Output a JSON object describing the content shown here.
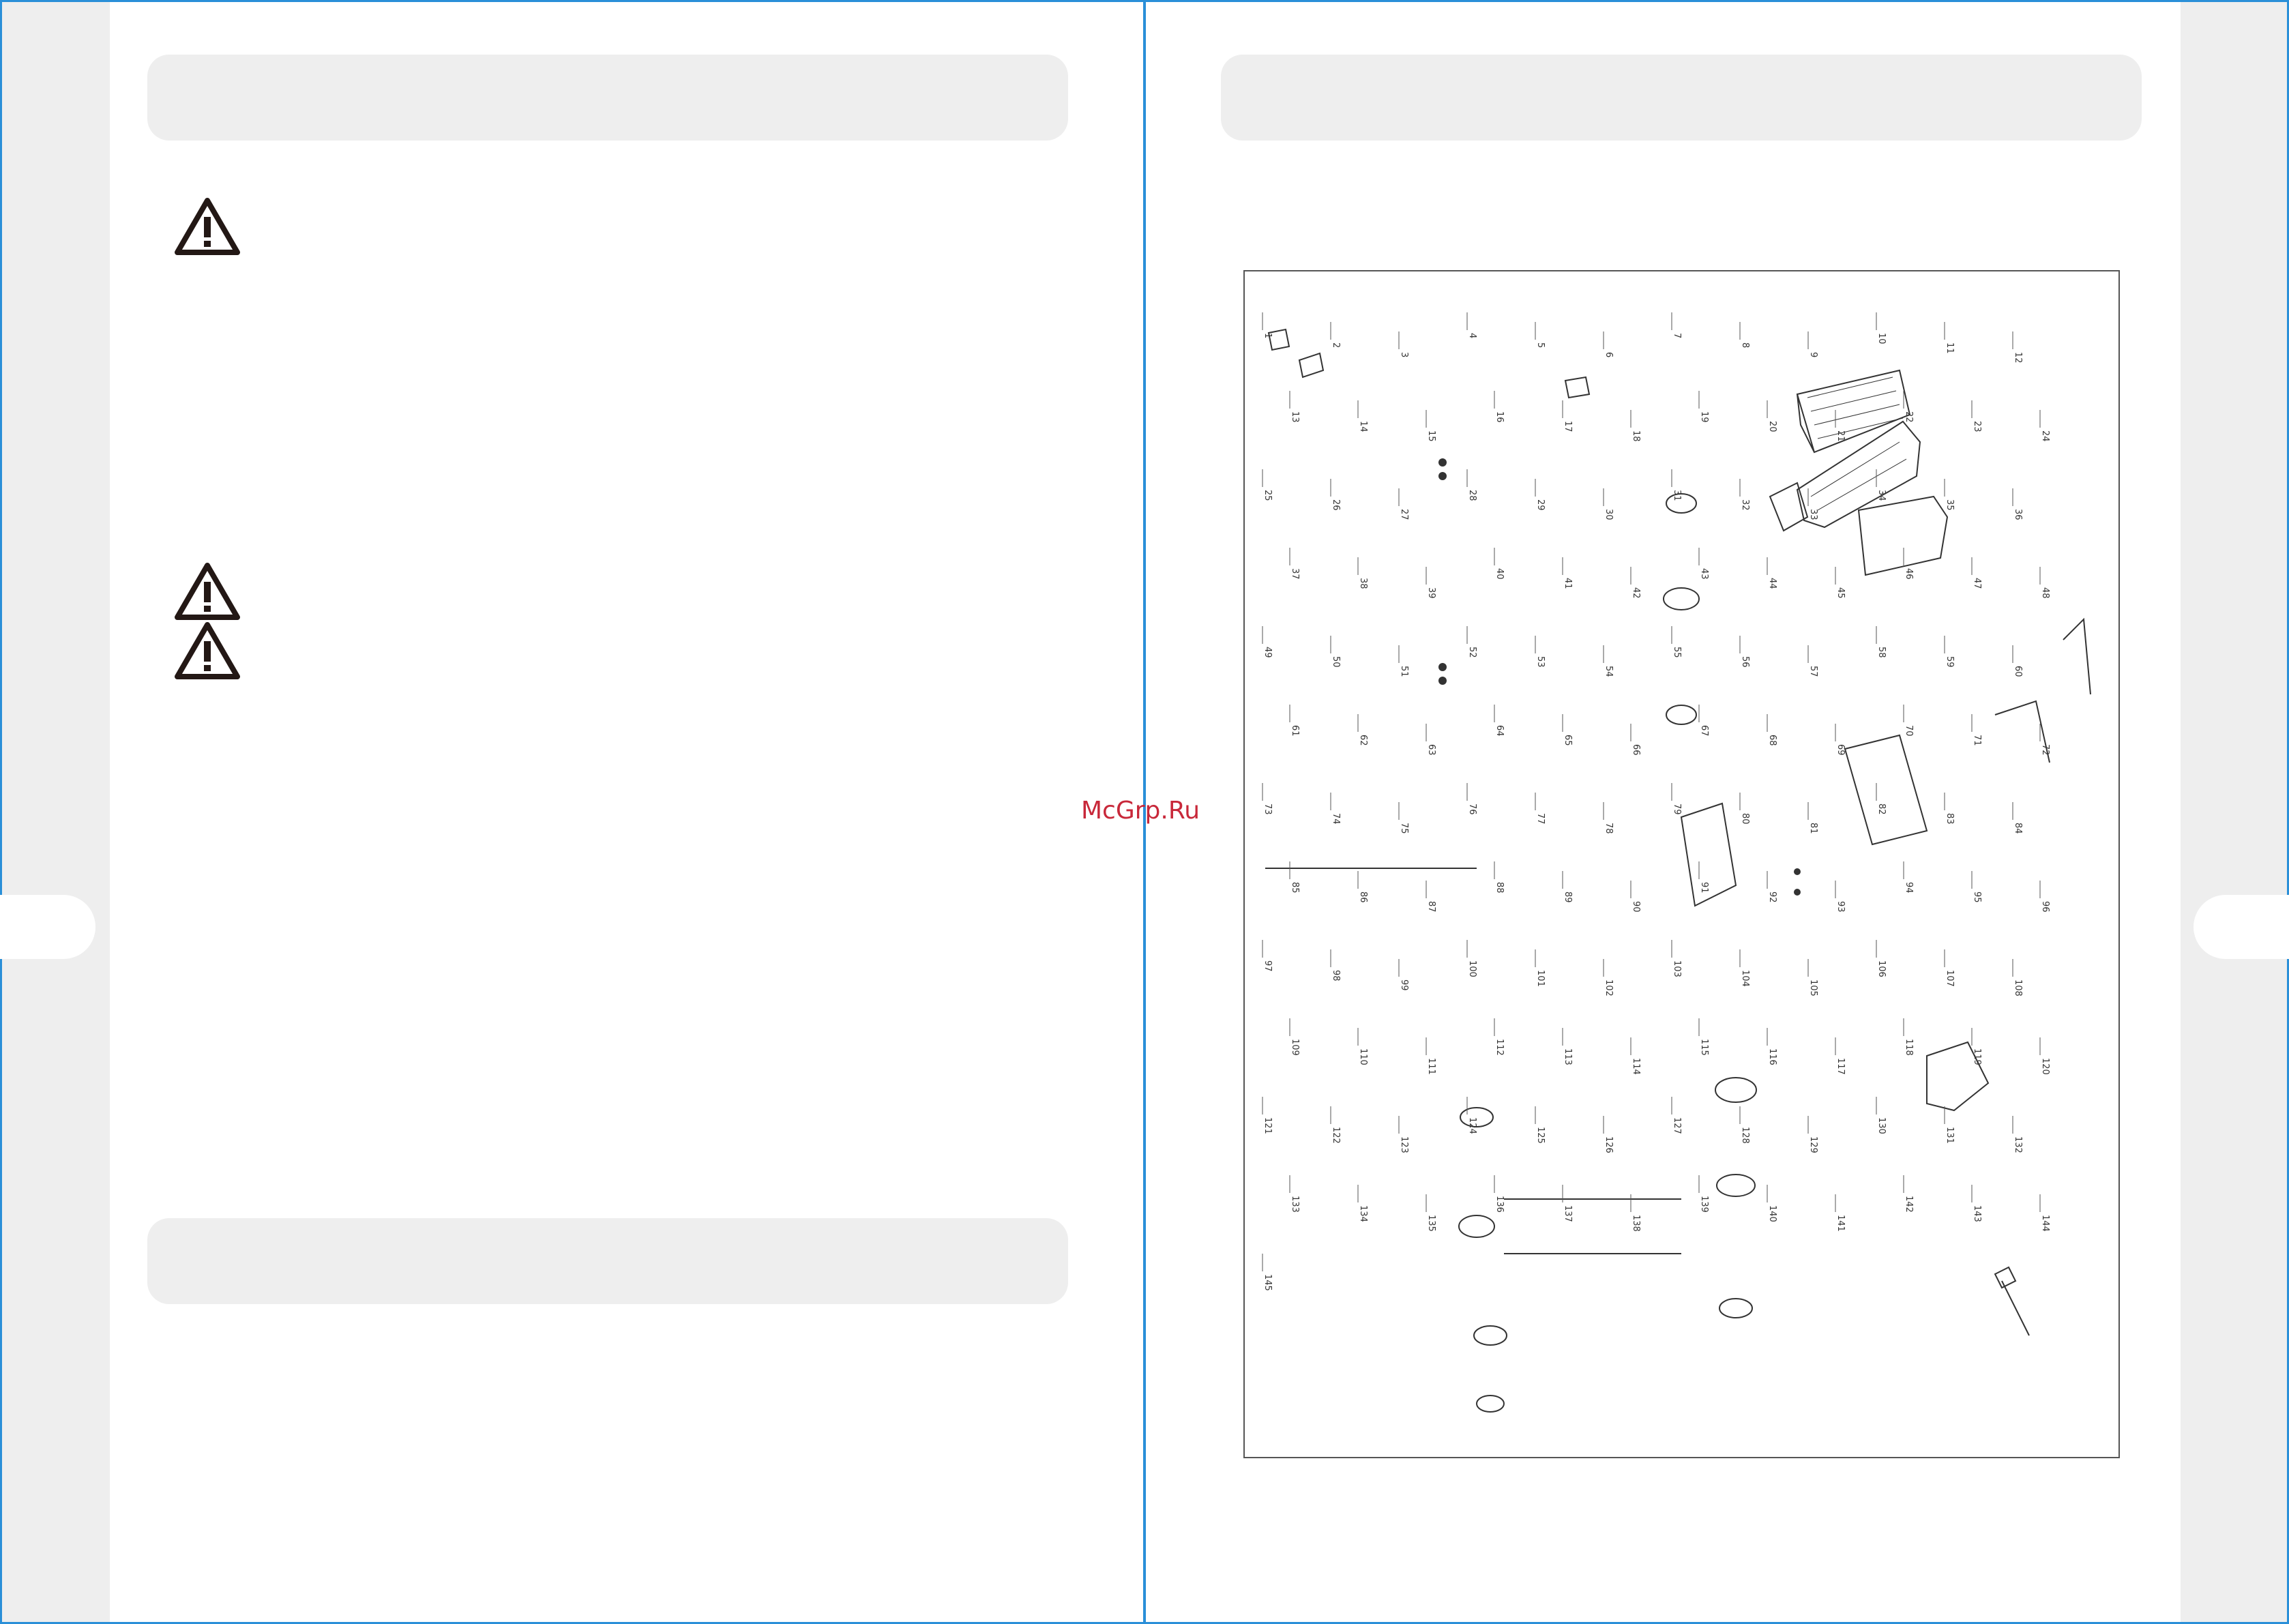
{
  "watermark": "McGrp.Ru",
  "icons": {
    "warning": "warning-triangle-icon"
  },
  "diagram": {
    "part_numbers": [
      "1",
      "2",
      "3",
      "4",
      "5",
      "6",
      "7",
      "8",
      "9",
      "10",
      "11",
      "12",
      "13",
      "14",
      "15",
      "16",
      "17",
      "18",
      "19",
      "20",
      "21",
      "22",
      "23",
      "24",
      "25",
      "26",
      "27",
      "28",
      "29",
      "30",
      "31",
      "32",
      "33",
      "34",
      "35",
      "36",
      "37",
      "38",
      "39",
      "40",
      "41",
      "42",
      "43",
      "44",
      "45",
      "46",
      "47",
      "48",
      "49",
      "50",
      "51",
      "52",
      "53",
      "54",
      "55",
      "56",
      "57",
      "58",
      "59",
      "60",
      "61",
      "62",
      "63",
      "64",
      "65",
      "66",
      "67",
      "68",
      "69",
      "70",
      "71",
      "72",
      "73",
      "74",
      "75",
      "76",
      "77",
      "78",
      "79",
      "80",
      "81",
      "82",
      "83",
      "84",
      "85",
      "86",
      "87",
      "88",
      "89",
      "90",
      "91",
      "92",
      "93",
      "94",
      "95",
      "96",
      "97",
      "98",
      "99",
      "100",
      "101",
      "102",
      "103",
      "104",
      "105",
      "106",
      "107",
      "108",
      "109",
      "110",
      "111",
      "112",
      "113",
      "114",
      "115",
      "116",
      "117",
      "118",
      "119",
      "120",
      "121",
      "122",
      "123",
      "124",
      "125",
      "126",
      "127",
      "128",
      "129",
      "130",
      "131",
      "132",
      "133",
      "134",
      "135",
      "136",
      "137",
      "138",
      "139",
      "140",
      "141",
      "142",
      "143",
      "144",
      "145"
    ]
  }
}
